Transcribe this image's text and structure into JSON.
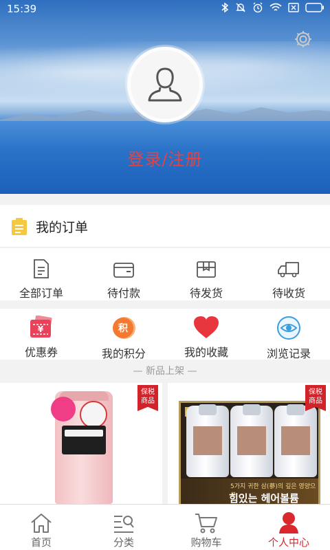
{
  "status_bar": {
    "time": "15:39"
  },
  "profile": {
    "login_label": "登录/注册"
  },
  "orders": {
    "title": "我的订单",
    "items": [
      {
        "label": "全部订单",
        "icon": "document-icon"
      },
      {
        "label": "待付款",
        "icon": "wallet-icon"
      },
      {
        "label": "待发货",
        "icon": "package-icon"
      },
      {
        "label": "待收货",
        "icon": "truck-icon"
      }
    ]
  },
  "tools": {
    "items": [
      {
        "label": "优惠券",
        "icon": "coupon-icon",
        "glyph": "¥"
      },
      {
        "label": "我的积分",
        "icon": "points-icon",
        "glyph": "积"
      },
      {
        "label": "我的收藏",
        "icon": "heart-icon"
      },
      {
        "label": "浏览记录",
        "icon": "eye-icon"
      }
    ]
  },
  "new_products": {
    "label": "— 新品上架 —"
  },
  "products": [
    {
      "badge_line1": "保税",
      "badge_line2": "商品"
    },
    {
      "badge_line1": "保税",
      "badge_line2": "商品",
      "text_line1": "5가지 귀한 삼(蔘)의 깊은 영양으로",
      "text_line2": "힘있는 헤어볼륨"
    }
  ],
  "tabbar": {
    "items": [
      {
        "label": "首页",
        "icon": "home-icon"
      },
      {
        "label": "分类",
        "icon": "category-icon"
      },
      {
        "label": "购物车",
        "icon": "cart-icon"
      },
      {
        "label": "个人中心",
        "icon": "person-icon"
      }
    ],
    "active_index": 3
  },
  "colors": {
    "accent": "#d9282e",
    "login_text": "#e8423f",
    "order_icon": "#f5c842"
  }
}
